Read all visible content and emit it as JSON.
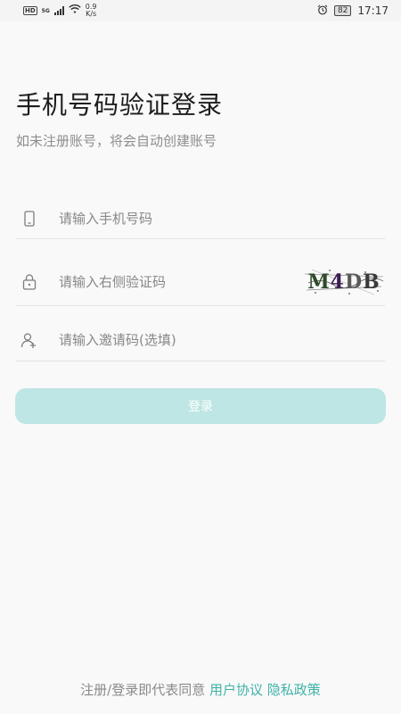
{
  "status_bar": {
    "hd": "HD",
    "network": "5G",
    "speed_value": "0.9",
    "speed_unit": "K/s",
    "battery": "82",
    "time": "17:17",
    "icons": [
      "signal-icon",
      "wifi-icon",
      "alarm-icon",
      "battery-icon"
    ]
  },
  "page": {
    "title": "手机号码验证登录",
    "subtitle": "如未注册账号，将会自动创建账号"
  },
  "form": {
    "phone": {
      "placeholder": "请输入手机号码",
      "value": "",
      "icon": "phone-icon"
    },
    "code": {
      "placeholder": "请输入右侧验证码",
      "value": "",
      "icon": "lock-icon"
    },
    "captcha": {
      "text": [
        "M",
        "4",
        "D",
        "B"
      ]
    },
    "invite": {
      "placeholder": "请输入邀请码(选填)",
      "value": "",
      "icon": "user-add-icon"
    }
  },
  "login_button": {
    "label": "登录"
  },
  "footer": {
    "prefix": "注册/登录即代表同意 ",
    "user_agreement": "用户协议",
    "privacy_policy": "隐私政策"
  },
  "colors": {
    "accent": "#3fb2a8",
    "button_disabled": "#bde6e4",
    "background": "#f9f9f9"
  }
}
